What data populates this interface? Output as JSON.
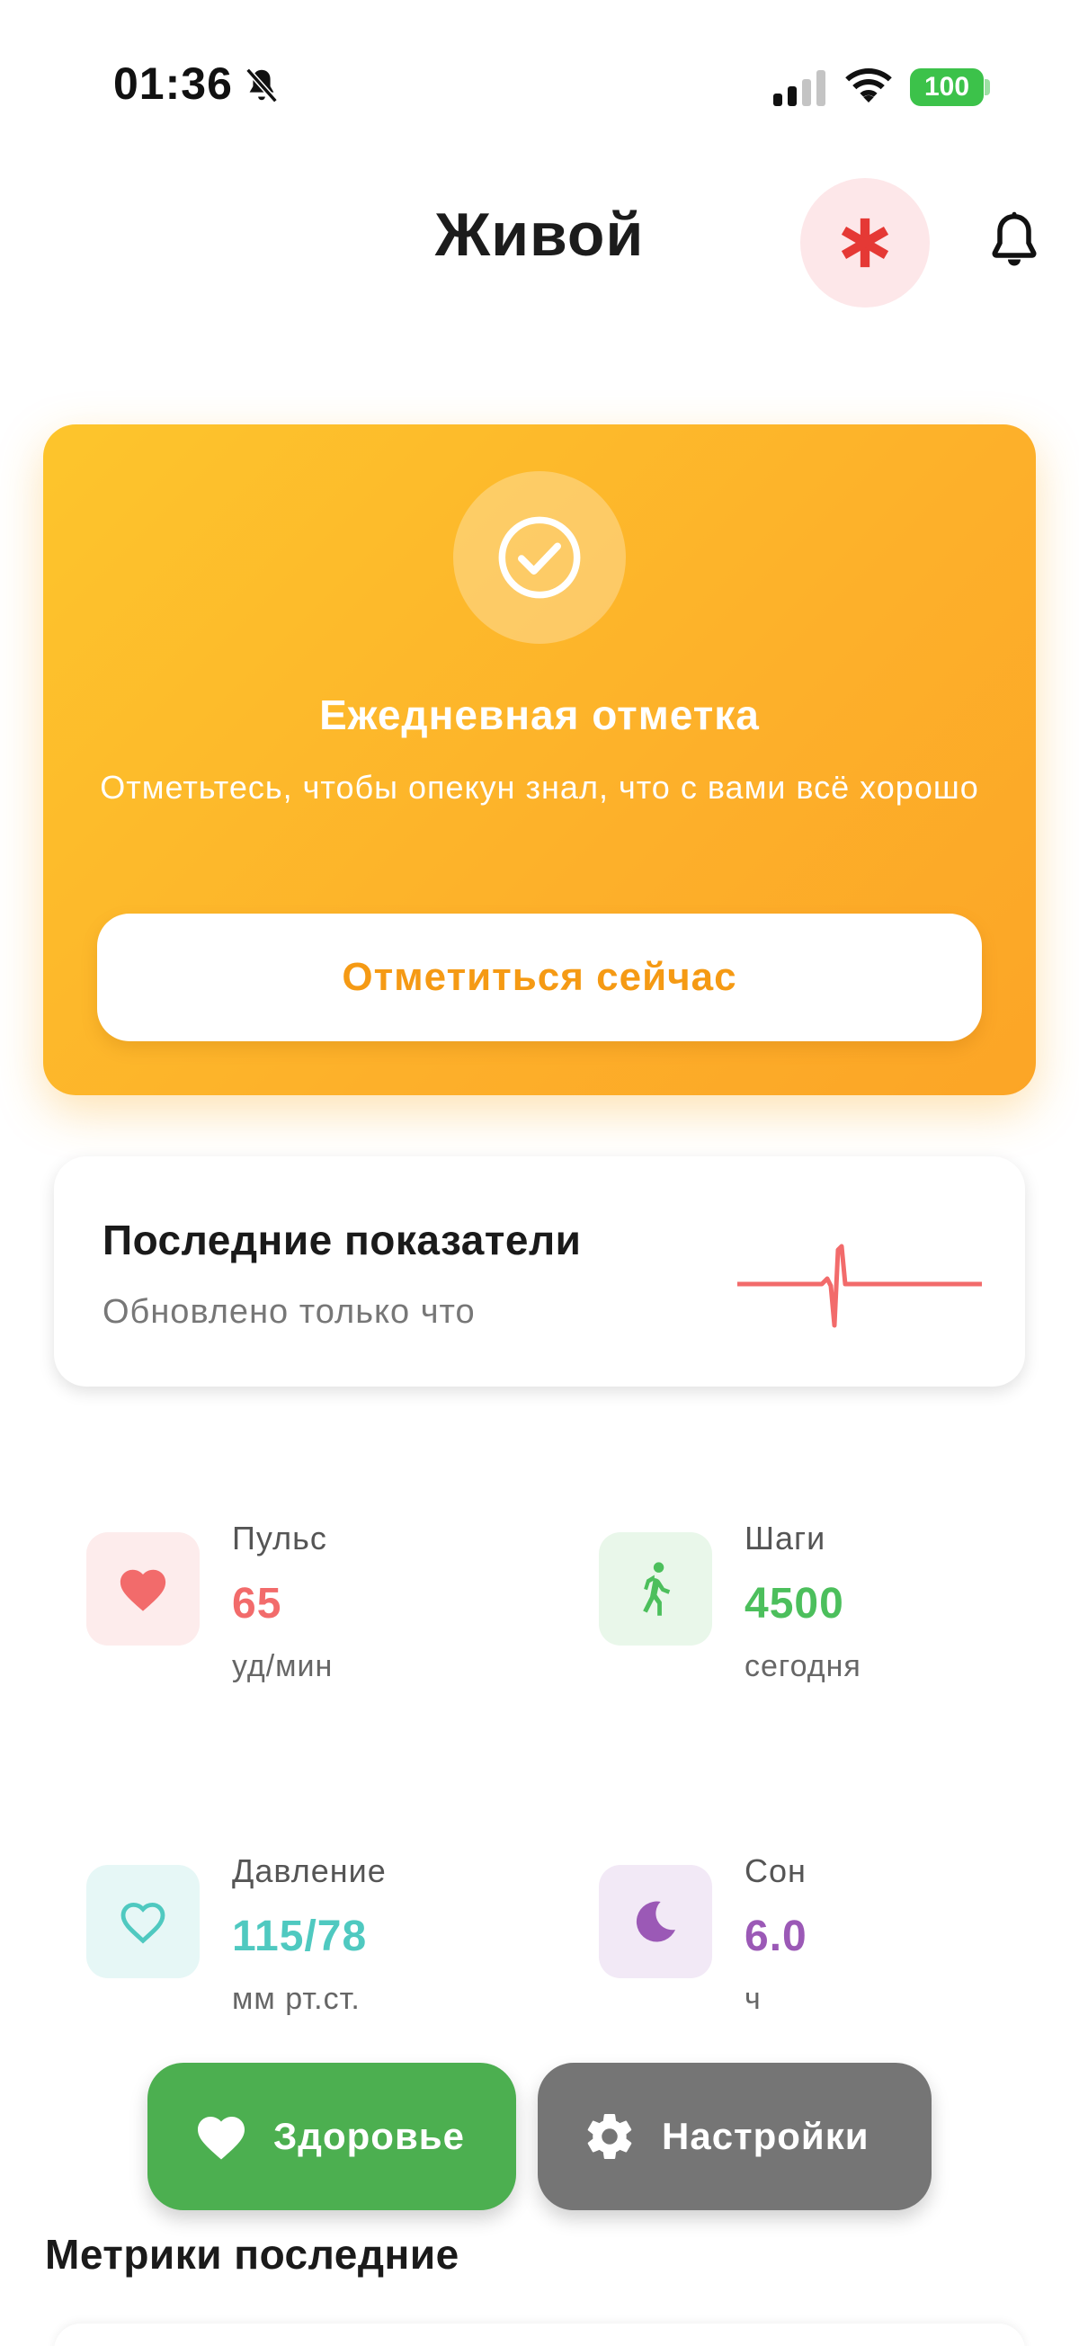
{
  "status_bar": {
    "time": "01:36",
    "battery": "100",
    "icons": [
      "bell-slash-icon",
      "cellular-signal-icon",
      "wifi-icon",
      "battery-icon"
    ]
  },
  "header": {
    "title": "Живой",
    "icons": [
      "sos-asterisk-icon",
      "bell-icon"
    ]
  },
  "checkin": {
    "title": "Ежедневная отметка",
    "subtitle": "Отметьтесь, чтобы опекун знал, что с вами всё хорошо",
    "button_label": "Отметиться сейчас",
    "icon": "check-circle-icon"
  },
  "latest": {
    "title": "Последние показатели",
    "subtitle": "Обновлено только что",
    "icon": "ecg-icon"
  },
  "metrics": [
    {
      "label": "Пульс",
      "value": "65",
      "unit": "уд/мин",
      "icon": "heart-icon",
      "color": "#f26b6b",
      "bg": "#fdecec"
    },
    {
      "label": "Шаги",
      "value": "4500",
      "unit": "сегодня",
      "icon": "walking-icon",
      "color": "#4cbf5c",
      "bg": "#e9f7ea"
    },
    {
      "label": "Давление",
      "value": "115/78",
      "unit": "мм рт.ст.",
      "icon": "heart-outline-icon",
      "color": "#4fc9c0",
      "bg": "#e6f7f6"
    },
    {
      "label": "Сон",
      "value": "6.0",
      "unit": "ч",
      "icon": "moon-icon",
      "color": "#9b59b6",
      "bg": "#f2e9f6"
    }
  ],
  "nav": {
    "health_label": "Здоровье",
    "settings_label": "Настройки"
  },
  "section": {
    "title": "Метрики последние"
  },
  "colors": {
    "accent_orange": "#fdb02a",
    "sos_red": "#e53935",
    "health_green": "#4caf50",
    "settings_gray": "#757575"
  }
}
